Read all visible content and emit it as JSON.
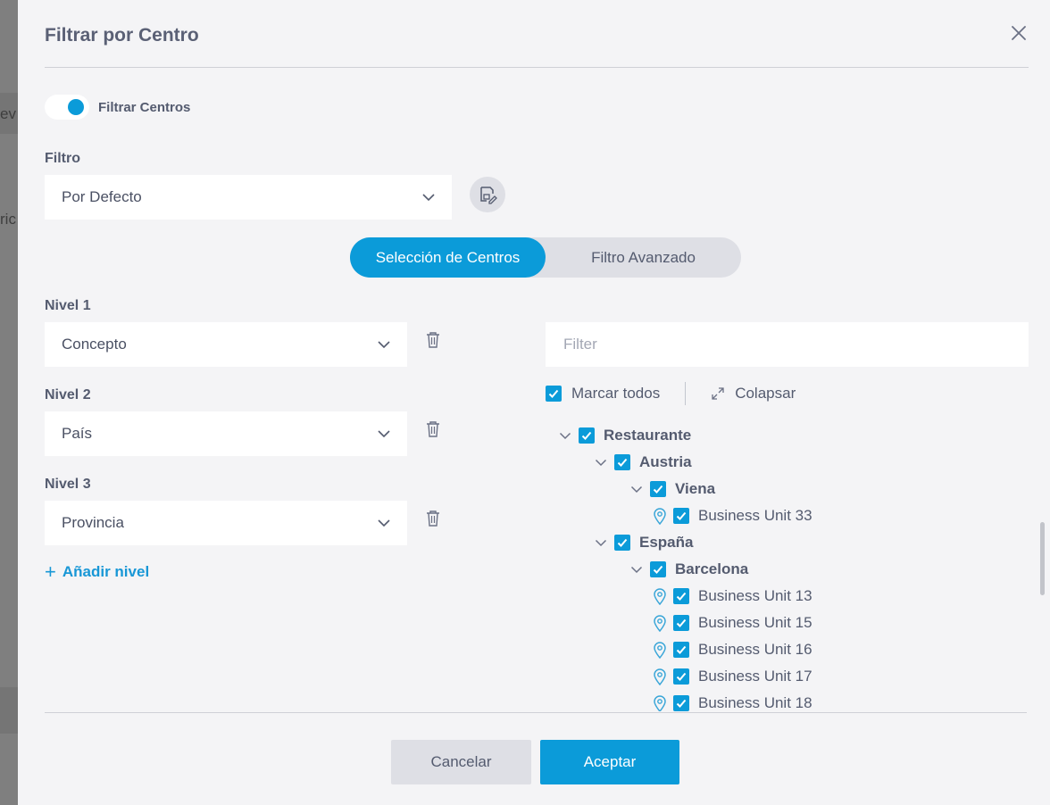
{
  "background": {
    "fragment_1": "ev",
    "fragment_2": "ric"
  },
  "dialog": {
    "title": "Filtrar por Centro",
    "close_icon": "close-icon"
  },
  "toggle": {
    "label": "Filtrar Centros",
    "on": true
  },
  "filter": {
    "label": "Filtro",
    "selected": "Por Defecto"
  },
  "segments": {
    "active": "Selección de Centros",
    "inactive": "Filtro Avanzado"
  },
  "levels": [
    {
      "label": "Nivel 1",
      "value": "Concepto"
    },
    {
      "label": "Nivel 2",
      "value": "País"
    },
    {
      "label": "Nivel 3",
      "value": "Provincia"
    }
  ],
  "add_level": "Añadir nivel",
  "tree_panel": {
    "filter_placeholder": "Filter",
    "check_all": "Marcar todos",
    "collapse": "Colapsar"
  },
  "tree": [
    {
      "label": "Restaurante",
      "type": "group",
      "level": 0
    },
    {
      "label": "Austria",
      "type": "group",
      "level": 1
    },
    {
      "label": "Viena",
      "type": "group",
      "level": 2
    },
    {
      "label": "Business Unit 33",
      "type": "leaf",
      "level": 3
    },
    {
      "label": "España",
      "type": "group",
      "level": 1
    },
    {
      "label": "Barcelona",
      "type": "group",
      "level": 2
    },
    {
      "label": "Business Unit 13",
      "type": "leaf",
      "level": 3
    },
    {
      "label": "Business Unit 15",
      "type": "leaf",
      "level": 3
    },
    {
      "label": "Business Unit 16",
      "type": "leaf",
      "level": 3
    },
    {
      "label": "Business Unit 17",
      "type": "leaf",
      "level": 3
    },
    {
      "label": "Business Unit 18",
      "type": "leaf",
      "level": 3
    }
  ],
  "buttons": {
    "cancel": "Cancelar",
    "accept": "Aceptar"
  },
  "colors": {
    "accent": "#0b9bd9",
    "text": "#545b6f",
    "surface": "#f4f4f6",
    "secondary": "#dedfe5"
  }
}
